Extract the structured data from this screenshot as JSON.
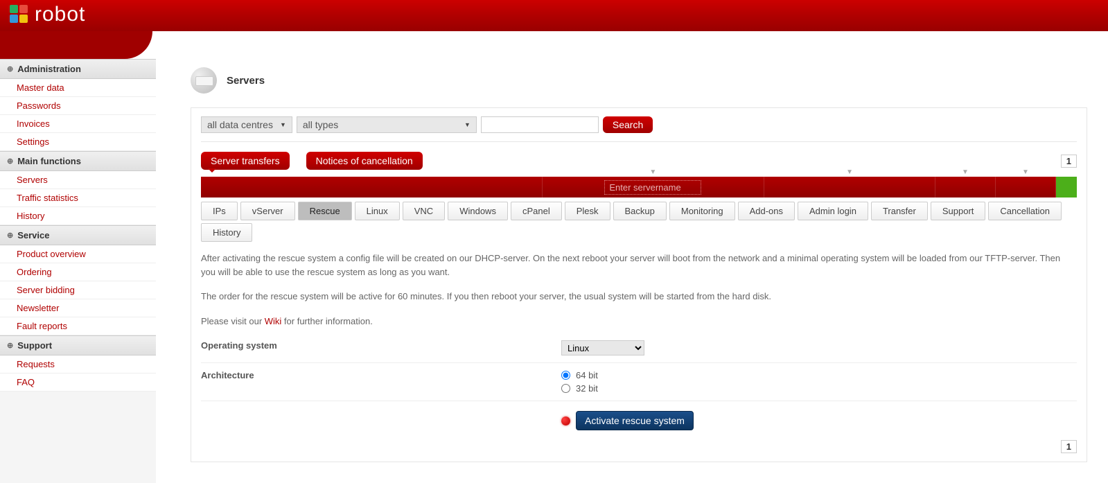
{
  "brand": "robot",
  "page_title": "Servers",
  "sidebar": {
    "sections": [
      {
        "title": "Administration",
        "items": [
          "Master data",
          "Passwords",
          "Invoices",
          "Settings"
        ]
      },
      {
        "title": "Main functions",
        "items": [
          "Servers",
          "Traffic statistics",
          "History"
        ]
      },
      {
        "title": "Service",
        "items": [
          "Product overview",
          "Ordering",
          "Server bidding",
          "Newsletter",
          "Fault reports"
        ]
      },
      {
        "title": "Support",
        "items": [
          "Requests",
          "FAQ"
        ]
      }
    ]
  },
  "filters": {
    "datacentre": "all data centres",
    "type": "all types",
    "search_value": "",
    "search_button": "Search"
  },
  "actions": {
    "server_transfers": "Server transfers",
    "notices": "Notices of cancellation"
  },
  "pagination": {
    "page": "1"
  },
  "server_row": {
    "servername_placeholder": "Enter servername"
  },
  "tabs": [
    "IPs",
    "vServer",
    "Rescue",
    "Linux",
    "VNC",
    "Windows",
    "cPanel",
    "Plesk",
    "Backup",
    "Monitoring",
    "Add-ons",
    "Admin login",
    "Transfer",
    "Support",
    "Cancellation",
    "History"
  ],
  "active_tab": "Rescue",
  "info": {
    "p1": "After activating the rescue system a config file will be created on our DHCP-server. On the next reboot your server will boot from the network and a minimal operating system will be loaded from our TFTP-server. Then you will be able to use the rescue system as long as you want.",
    "p2": "The order for the rescue system will be active for 60 minutes. If you then reboot your server, the usual system will be started from the hard disk.",
    "p3_pre": "Please visit our ",
    "p3_link": "Wiki",
    "p3_post": " for further information."
  },
  "form": {
    "os_label": "Operating system",
    "os_value": "Linux",
    "arch_label": "Architecture",
    "arch_options": [
      "64 bit",
      "32 bit"
    ],
    "arch_selected": "64 bit",
    "activate_button": "Activate rescue system"
  }
}
